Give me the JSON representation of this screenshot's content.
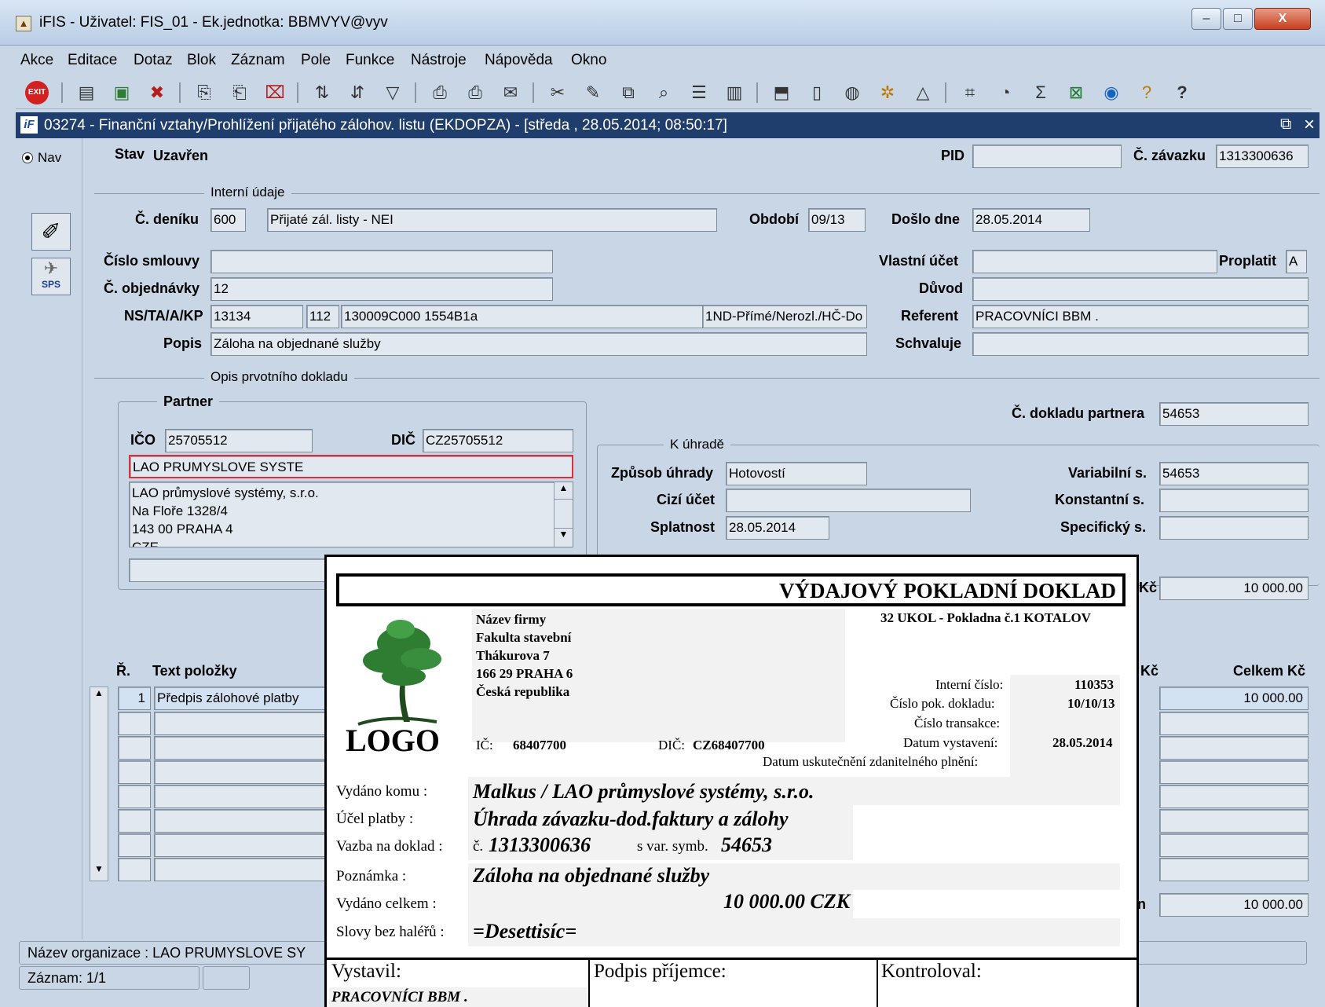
{
  "window": {
    "title": "iFIS - Uživatel: FIS_01 - Ek.jednotka: BBMVYV@vyv",
    "controls": {
      "minimize": "–",
      "maximize": "□",
      "close": "X"
    }
  },
  "menu": [
    "Akce",
    "Editace",
    "Dotaz",
    "Blok",
    "Záznam",
    "Pole",
    "Funkce",
    "Nástroje",
    "Nápověda",
    "Okno"
  ],
  "form_window": {
    "title": "03274 - Finanční vztahy/Prohlížení přijatého zálohov. listu (EKDOPZA) - [středa , 28.05.2014; 08:50:17]",
    "icon": "iF"
  },
  "leftbar": {
    "mode_label": "Nav",
    "sps_label": "SPS"
  },
  "form": {
    "stav_label": "Stav",
    "stav_value": "Uzavřen",
    "pid_label": "PID",
    "pid_value": "",
    "zavazek_label": "Č. závazku",
    "zavazek_value": "1313300636",
    "section_interni": "Interní údaje",
    "denik_label": "Č. deníku",
    "denik_value": "600",
    "denik_name": "Přijaté zál. listy -  NEI",
    "obdobi_label": "Období",
    "obdobi_value": "09/13",
    "doslo_label": "Došlo dne",
    "doslo_value": "28.05.2014",
    "smlouva_label": "Číslo smlouvy",
    "smlouva_value": "",
    "vlastni_label": "Vlastní účet",
    "vlastni_value": "",
    "proplatit_label": "Proplatit",
    "proplatit_value": "A",
    "objednavka_label": "Č. objednávky",
    "objednavka_value": "12",
    "duvod_label": "Důvod",
    "duvod_value": "",
    "ns_label": "NS/TA/A/KP",
    "ns_value": "13134",
    "ta_value": "112",
    "a_value": "130009C000 1554B1a",
    "kp_value": "1ND-Přímé/Nerozl./HČ-Do",
    "referent_label": "Referent",
    "referent_value": "PRACOVNÍCI BBM .",
    "popis_label": "Popis",
    "popis_value": "Záloha na objednané služby",
    "schvaluje_label": "Schvaluje",
    "schvaluje_value": "",
    "section_opis": "Opis prvotního dokladu",
    "partner_label": "Partner",
    "ico_label": "IČO",
    "ico_value": "25705512",
    "dic_label": "DIČ",
    "dic_value": "CZ25705512",
    "partner_short": "LAO PRUMYSLOVE SYSTE",
    "partner_address": [
      "LAO průmyslové systémy, s.r.o.",
      "Na Floře 1328/4",
      "143 00 PRAHA 4",
      "CZE"
    ],
    "doklad_partnera_label": "Č. dokladu partnera",
    "doklad_partnera_value": "54653",
    "section_uhrada": "K úhradě",
    "zpusob_label": "Způsob úhrady",
    "zpusob_value": "Hotovostí",
    "variabilni_label": "Variabilní s.",
    "variabilni_value": "54653",
    "cizi_label": "Cizí účet",
    "cizi_value": "",
    "konstantni_label": "Konstantní s.",
    "konstantni_value": "",
    "splatnost_label": "Splatnost",
    "splatnost_value": "28.05.2014",
    "specificky_label": "Specifický s.",
    "specificky_value": "",
    "amount_label_tail": "Kč",
    "amount_value": "10 000.00",
    "grid_r_label": "Ř.",
    "grid_text_label": "Text položky",
    "grid_kc_label": "Kč",
    "grid_celkem_label": "Celkem Kč",
    "row1_num": "1",
    "row1_text": "Předpis zálohové platby",
    "row1_celkem": "10 000.00",
    "total_label_tail": "n",
    "total_value": "10 000.00"
  },
  "status": {
    "organizace": "Název organizace : LAO PRUMYSLOVE SY",
    "zaznam": "Záznam: 1/1"
  },
  "receipt": {
    "title": "VÝDAJOVÝ POKLADNÍ DOKLAD",
    "logo_text": "LOGO",
    "company": [
      "Název firmy",
      "Fakulta stavební",
      "Thákurova 7",
      "166 29 PRAHA 6",
      "Česká republika"
    ],
    "pokladna": "32 UKOL - Pokladna č.1 KOTALOV",
    "ic_label": "IČ:",
    "ic_value": "68407700",
    "dic_label": "DIČ:",
    "dic_value": "CZ68407700",
    "interni_label": "Interní číslo:",
    "interni_value": "110353",
    "pok_label": "Číslo pok. dokladu:",
    "pok_value": "10/10/13",
    "transakce_label": "Číslo transakce:",
    "vystaveni_label": "Datum vystavení:",
    "vystaveni_value": "28.05.2014",
    "uskutecneni_label": "Datum uskutečnění zdanitelného plnění:",
    "vydano_komu_label": "Vydáno komu :",
    "vydano_komu_value": "Malkus / LAO průmyslové systémy, s.r.o.",
    "ucel_label": "Účel platby :",
    "ucel_value": "Úhrada závazku-dod.faktury a zálohy",
    "vazba_label": "Vazba na doklad :",
    "vazba_c": "č.",
    "vazba_value": "1313300636",
    "var_symb_label": "s var. symb.",
    "var_symb_value": "54653",
    "poznamka_label": "Poznámka :",
    "poznamka_value": "Záloha na objednané služby",
    "celkem_label": "Vydáno celkem :",
    "celkem_value": "10 000.00 CZK",
    "slovy_label": "Slovy bez haléřů :",
    "slovy_value": "=Desettisíc=",
    "vystavil_label": "Vystavil:",
    "podpis_label": "Podpis příjemce:",
    "kontroloval_label": "Kontroloval:",
    "vystavil_value": "PRACOVNÍCI BBM ."
  }
}
